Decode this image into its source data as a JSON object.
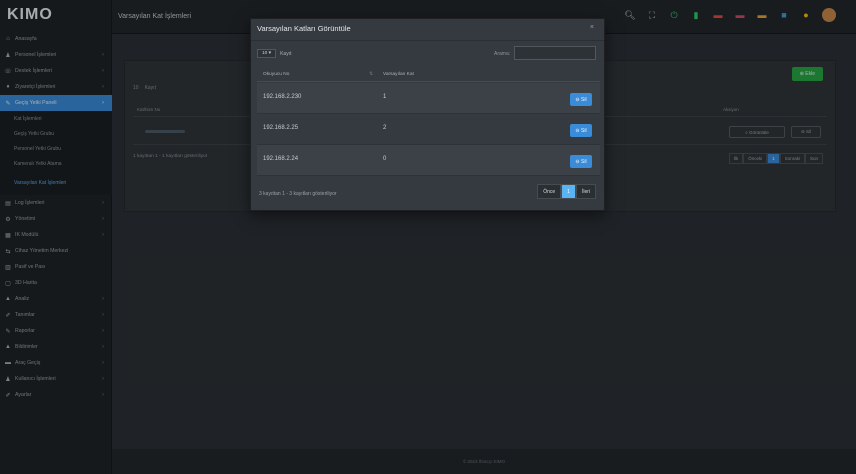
{
  "app": {
    "logo": "KIMO",
    "page_title": "Varsayılan Kat İşlemleri"
  },
  "sidebar": {
    "items": [
      {
        "label": "Anasayfa",
        "icon": "home-icon",
        "glyph": "⌂",
        "chev": false,
        "active": false
      },
      {
        "label": "Personel İşlemleri",
        "icon": "users-icon",
        "glyph": "♟",
        "chev": true,
        "active": false
      },
      {
        "label": "Destek İşlemleri",
        "icon": "headset-icon",
        "glyph": "☏",
        "chev": true,
        "active": false
      },
      {
        "label": "Ziyaretçi İşlemleri",
        "icon": "visitor-icon",
        "glyph": "♦",
        "chev": true,
        "active": false
      },
      {
        "label": "Geçiş Yetki Paneli",
        "icon": "key-icon",
        "glyph": "✎",
        "chev": true,
        "active": true
      }
    ],
    "subitems": [
      {
        "label": "Kat İşlemleri",
        "current": false,
        "tall": false
      },
      {
        "label": "Geçiş Yetki Grubu",
        "current": false,
        "tall": false
      },
      {
        "label": "Personel Yetki Grubu",
        "current": false,
        "tall": false
      },
      {
        "label": "Kameralı Yetki Atama",
        "current": false,
        "tall": false
      },
      {
        "label": "Varsayılan Kat İşlemleri",
        "current": true,
        "tall": true
      }
    ],
    "items2": [
      {
        "label": "Log İşlemleri",
        "icon": "log-icon",
        "glyph": "▤",
        "chev": true
      },
      {
        "label": "Yönetimi",
        "icon": "cog-icon",
        "glyph": "⚙",
        "chev": true
      },
      {
        "label": "IK Modülü",
        "icon": "hr-icon",
        "glyph": "▦",
        "chev": true
      },
      {
        "label": "Cihaz Yönetim Merkezi",
        "icon": "devices-icon",
        "glyph": "⇆",
        "chev": false
      },
      {
        "label": "Pasif ve Pası",
        "icon": "card-icon",
        "glyph": "▥",
        "chev": false
      },
      {
        "label": "3D Harita",
        "icon": "map-icon",
        "glyph": "▢",
        "chev": false
      },
      {
        "label": "Analiz",
        "icon": "chart-icon",
        "glyph": "▲",
        "chev": true
      },
      {
        "label": "Tanımlar",
        "icon": "wrench-icon",
        "glyph": "✐",
        "chev": true
      },
      {
        "label": "Raporlar",
        "icon": "report-icon",
        "glyph": "✎",
        "chev": true
      },
      {
        "label": "Bildirimler",
        "icon": "bell-icon",
        "glyph": "▲",
        "chev": true
      },
      {
        "label": "Araç Geçiş",
        "icon": "car-icon",
        "glyph": "▬",
        "chev": true
      },
      {
        "label": "Kullanıcı İşlemleri",
        "icon": "user-cog-icon",
        "glyph": "♟",
        "chev": true
      },
      {
        "label": "Ayarlar",
        "icon": "settings-icon",
        "glyph": "✐",
        "chev": true
      }
    ]
  },
  "topbar": {
    "icons": [
      {
        "name": "search-icon",
        "glyph": "🔍︎",
        "color": "#c9cdd1"
      },
      {
        "name": "fullscreen-icon",
        "glyph": "⛶",
        "color": "#c9cdd1"
      },
      {
        "name": "power-icon",
        "glyph": "⏻",
        "color": "#2ecc71"
      },
      {
        "name": "battery-icon",
        "glyph": "▮",
        "color": "#2ecc71"
      },
      {
        "name": "flag-tr-icon",
        "glyph": "▬",
        "color": "#e74c3c"
      },
      {
        "name": "flag-us-icon",
        "glyph": "▬",
        "color": "#d14a6a"
      },
      {
        "name": "flag-de-icon",
        "glyph": "▬",
        "color": "#e9a13b"
      },
      {
        "name": "flag-az-icon",
        "glyph": "■",
        "color": "#3aa0d8"
      },
      {
        "name": "notification-icon",
        "glyph": "●",
        "color": "#f1c40f"
      }
    ]
  },
  "background_card": {
    "new_button": "⊕ Ekle",
    "show_count": "10",
    "records_label": "Kayıt",
    "col_name": "Kat/İsim No",
    "col_actions": "Aksiyon",
    "btn_view": "⌕ Görüntüle",
    "btn_delete": "⊖ Sil",
    "info": "1 kayıttan 1 - 1 kayıtları gösteriliyor",
    "pagination": [
      "İlk",
      "Önceki",
      "1",
      "Sonraki",
      "Son"
    ]
  },
  "modal": {
    "title": "Varsayılan Katları Görüntüle",
    "close": "×",
    "show_count": "10",
    "records_label": "Kayıt",
    "search_label": "Arama:",
    "search_value": "",
    "col_ip": "Okuyucu No",
    "col_count": "Varsayılan Kat",
    "delete_label": "⊖ Sil",
    "rows": [
      {
        "ip": "192.168.2.230",
        "count": "1"
      },
      {
        "ip": "192.168.2.25",
        "count": "2"
      },
      {
        "ip": "192.168.2.24",
        "count": "0"
      }
    ],
    "info": "3 kayıttan 1 - 3 kayıtları gösteriliyor",
    "pagination": [
      "Önce",
      "1",
      "İleri"
    ]
  },
  "footer": {
    "text": "© 2023 İhracçı KIMO"
  }
}
